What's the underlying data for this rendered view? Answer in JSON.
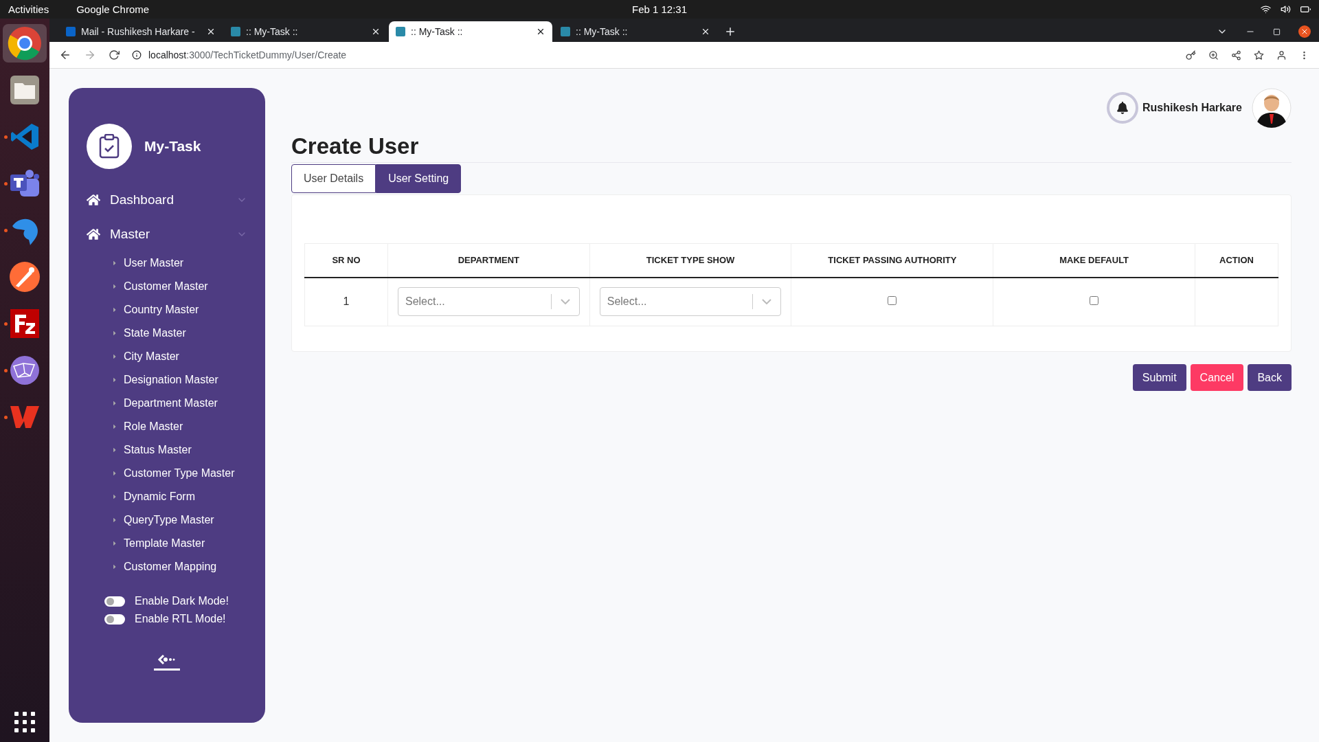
{
  "os_bar": {
    "activities": "Activities",
    "app": "Google Chrome",
    "clock": "Feb 1  12:31"
  },
  "dock": [
    {
      "running": false,
      "selected": true
    },
    {
      "running": false,
      "selected": false
    },
    {
      "running": true,
      "selected": false
    },
    {
      "running": true,
      "selected": false
    },
    {
      "running": true,
      "selected": false
    },
    {
      "running": false,
      "selected": false
    },
    {
      "running": true,
      "selected": false
    },
    {
      "running": true,
      "selected": false
    },
    {
      "running": true,
      "selected": false
    }
  ],
  "browser": {
    "tabs": [
      {
        "title": "Mail - Rushikesh Harkare -",
        "selected": false
      },
      {
        "title": ":: My-Task ::",
        "selected": false
      },
      {
        "title": ":: My-Task ::",
        "selected": true
      },
      {
        "title": ":: My-Task ::",
        "selected": false
      }
    ],
    "url_host": "localhost",
    "url_path": ":3000/TechTicketDummy/User/Create"
  },
  "sidebar": {
    "brand": "My-Task",
    "menu": [
      {
        "label": "Dashboard"
      },
      {
        "label": "Master",
        "children": [
          "User Master",
          "Customer Master",
          "Country Master",
          "State Master",
          "City Master",
          "Designation Master",
          "Department Master",
          "Role Master",
          "Status Master",
          "Customer Type Master",
          "Dynamic Form",
          "QueryType Master",
          "Template Master",
          "Customer Mapping"
        ]
      }
    ],
    "toggles": [
      {
        "label": "Enable Dark Mode!",
        "on": false
      },
      {
        "label": "Enable RTL Mode!",
        "on": false
      }
    ]
  },
  "header": {
    "user_name": "Rushikesh Harkare"
  },
  "page_title": "Create User",
  "tabs": [
    {
      "label": "User Details",
      "selected": false
    },
    {
      "label": "User Setting",
      "selected": true
    }
  ],
  "table": {
    "columns": [
      "SR NO",
      "DEPARTMENT",
      "TICKET TYPE SHOW",
      "TICKET PASSING AUTHORITY",
      "MAKE DEFAULT",
      "ACTION"
    ],
    "rows": [
      {
        "sr_no": "1",
        "department": {
          "placeholder": "Select..."
        },
        "ticket_type_show": {
          "placeholder": "Select..."
        },
        "ticket_passing_authority": false,
        "make_default": false
      }
    ]
  },
  "buttons": [
    {
      "label": "Submit",
      "kind": "primary"
    },
    {
      "label": "Cancel",
      "kind": "danger"
    },
    {
      "label": "Back",
      "kind": "primary"
    }
  ]
}
